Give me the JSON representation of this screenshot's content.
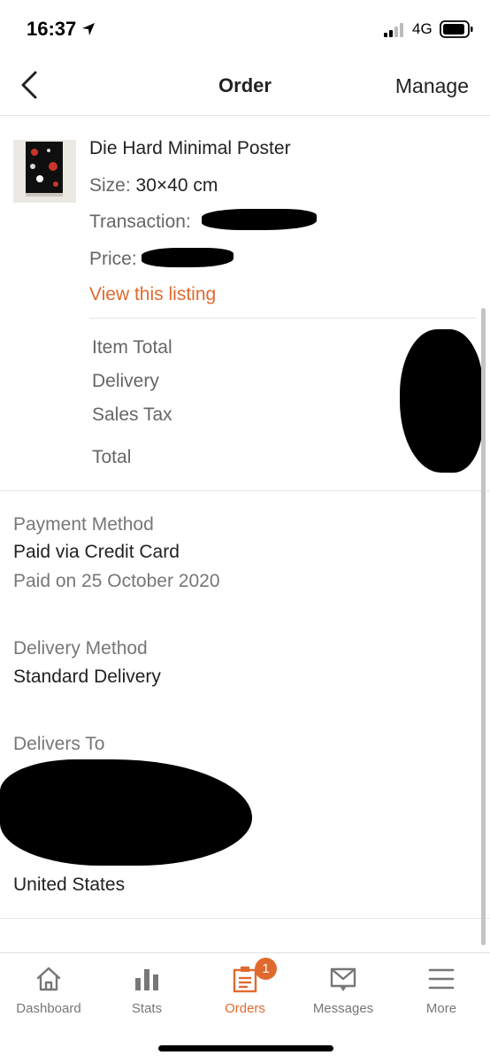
{
  "status": {
    "time": "16:37",
    "network": "4G",
    "icons": [
      "location-arrow-icon",
      "signal-icon",
      "battery-icon"
    ]
  },
  "nav": {
    "back_icon": "chevron-left-icon",
    "title": "Order",
    "manage_label": "Manage"
  },
  "item": {
    "title": "Die Hard Minimal Poster",
    "size_label": "Size:",
    "size_value": "30×40 cm",
    "transaction_label": "Transaction:",
    "price_label": "Price:",
    "view_listing": "View this listing"
  },
  "totals": {
    "item_total": "Item Total",
    "delivery": "Delivery",
    "sales_tax": "Sales Tax",
    "total": "Total"
  },
  "payment": {
    "label": "Payment Method",
    "method": "Paid via Credit Card",
    "date": "Paid on 25 October 2020"
  },
  "delivery": {
    "label": "Delivery Method",
    "method": "Standard Delivery"
  },
  "address": {
    "label": "Delivers To",
    "country": "United States"
  },
  "tabs": [
    {
      "label": "Dashboard",
      "icon": "home-icon"
    },
    {
      "label": "Stats",
      "icon": "bar-chart-icon"
    },
    {
      "label": "Orders",
      "icon": "clipboard-icon",
      "badge": "1"
    },
    {
      "label": "Messages",
      "icon": "envelope-icon"
    },
    {
      "label": "More",
      "icon": "menu-icon"
    }
  ],
  "colors": {
    "accent": "#e06a2e",
    "text": "#222222",
    "muted": "#777777",
    "divider": "#e6e6e6"
  }
}
